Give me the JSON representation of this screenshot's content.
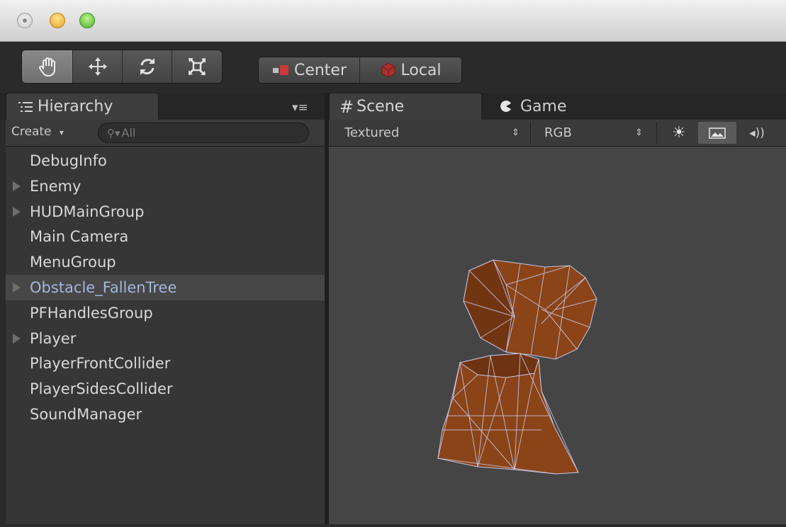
{
  "window": {},
  "toolbar": {
    "tools": [
      {
        "icon": "hand-icon",
        "active": true
      },
      {
        "icon": "move-icon",
        "active": false
      },
      {
        "icon": "rotate-icon",
        "active": false
      },
      {
        "icon": "scale-icon",
        "active": false
      }
    ],
    "pivot_label": "Center",
    "space_label": "Local"
  },
  "hierarchy": {
    "tab_label": "Hierarchy",
    "create_label": "Create",
    "search_placeholder": "All",
    "items": [
      {
        "label": "DebugInfo",
        "expandable": false,
        "selected": false
      },
      {
        "label": "Enemy",
        "expandable": true,
        "selected": false
      },
      {
        "label": "HUDMainGroup",
        "expandable": true,
        "selected": false
      },
      {
        "label": "Main Camera",
        "expandable": false,
        "selected": false
      },
      {
        "label": "MenuGroup",
        "expandable": false,
        "selected": false
      },
      {
        "label": "Obstacle_FallenTree",
        "expandable": true,
        "selected": true
      },
      {
        "label": "PFHandlesGroup",
        "expandable": false,
        "selected": false
      },
      {
        "label": "Player",
        "expandable": true,
        "selected": false
      },
      {
        "label": "PlayerFrontCollider",
        "expandable": false,
        "selected": false
      },
      {
        "label": "PlayerSidesCollider",
        "expandable": false,
        "selected": false
      },
      {
        "label": "SoundManager",
        "expandable": false,
        "selected": false
      }
    ]
  },
  "scene": {
    "tab_label": "Scene",
    "game_tab_label": "Game",
    "render_mode": "Textured",
    "color_mode": "RGB"
  },
  "colors": {
    "panel_bg": "#363636",
    "selected_text": "#a2b6de",
    "viewport_bg": "#454545",
    "mesh_fill": "#8a4418",
    "wire": "#c9c6e6"
  }
}
